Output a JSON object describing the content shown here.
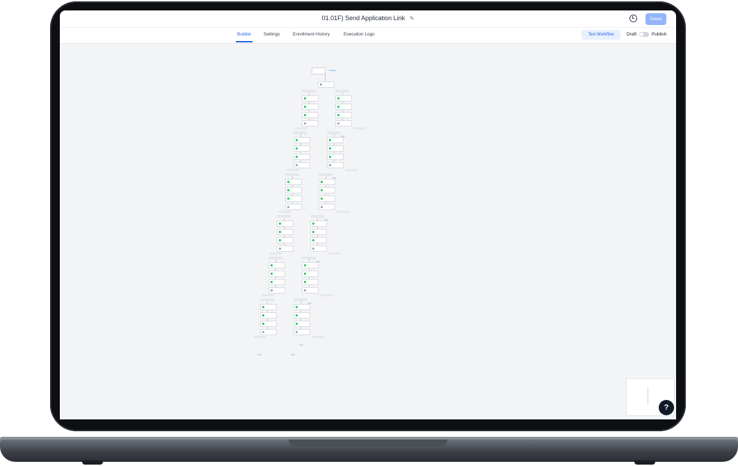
{
  "header": {
    "title": "01.01F) Send Application Link",
    "saved_label": "Saved"
  },
  "tabs": [
    {
      "label": "Builder",
      "active": true
    },
    {
      "label": "Settings",
      "active": false
    },
    {
      "label": "Enrollment History",
      "active": false
    },
    {
      "label": "Execution Logs",
      "active": false
    }
  ],
  "toolbar": {
    "test_workflow_label": "Test Workflow",
    "draft_label": "Draft",
    "publish_label": "Publish"
  },
  "help": {
    "label": "?"
  },
  "icons": {
    "edit": "pencil-icon",
    "history": "history-icon",
    "help": "help-icon"
  },
  "colors": {
    "accent": "#2563eb",
    "saved_button": "#93b4fb",
    "canvas": "#f3f4f6"
  }
}
